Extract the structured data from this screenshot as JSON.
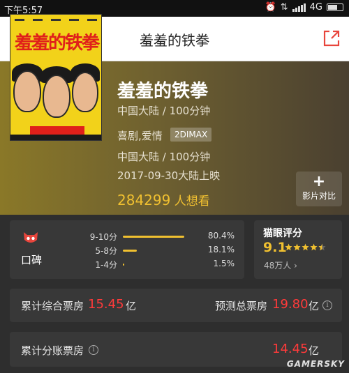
{
  "status_bar": {
    "time": "下午5:57",
    "network": "4G"
  },
  "header": {
    "title": "羞羞的铁拳"
  },
  "movie": {
    "title": "羞羞的铁拳",
    "region_duration_1": "中国大陆 / 100分钟",
    "genres": "喜剧,爱情",
    "format_tag": "2DIMAX",
    "region_duration_2": "中国大陆 / 100分钟",
    "release": "2017-09-30大陆上映",
    "want_count": "284299",
    "want_label": "人想看",
    "compare_label": "影片对比",
    "poster_title": "羞羞的铁拳"
  },
  "word_of_mouth": {
    "label": "口碑",
    "rows": [
      {
        "range": "9-10分",
        "percent": "80.4%",
        "fill": 0.804
      },
      {
        "range": "5-8分",
        "percent": "18.1%",
        "fill": 0.181
      },
      {
        "range": "1-4分",
        "percent": "1.5%",
        "fill": 0.015
      }
    ]
  },
  "maoyan": {
    "label": "猫眼评分",
    "score": "9.1",
    "stars": 4.5,
    "count": "48万人"
  },
  "box_office": {
    "total_label": "累计综合票房",
    "total_value": "15.45",
    "total_unit": "亿",
    "predict_label": "预测总票房",
    "predict_value": "19.80",
    "predict_unit": "亿",
    "split_label": "累计分账票房",
    "split_value": "14.45",
    "split_unit": "亿"
  },
  "watermark": "GAMERSKY",
  "colors": {
    "accent": "#f0c030",
    "red": "#ff3a3a",
    "header_red": "#e8453c"
  }
}
